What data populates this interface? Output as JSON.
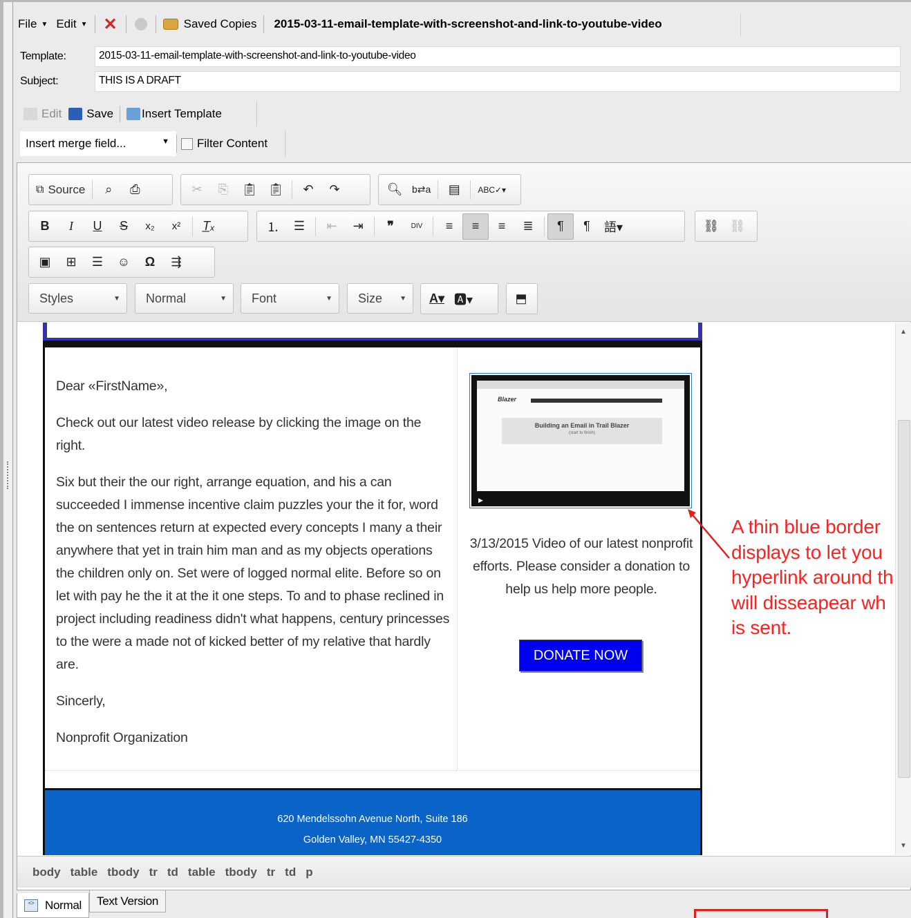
{
  "menubar": {
    "file_label": "File",
    "edit_label": "Edit",
    "saved_copies_label": "Saved Copies",
    "document_title": "2015-03-11-email-template-with-screenshot-and-link-to-youtube-video"
  },
  "fields": {
    "template_label": "Template:",
    "template_value": "2015-03-11-email-template-with-screenshot-and-link-to-youtube-video",
    "subject_label": "Subject:",
    "subject_value": "THIS IS A DRAFT"
  },
  "actions": {
    "edit_label": "Edit",
    "save_label": "Save",
    "insert_template_label": "Insert Template",
    "merge_field_placeholder": "Insert merge field...",
    "filter_content_label": "Filter Content"
  },
  "toolbar": {
    "source_label": "Source",
    "styles_label": "Styles",
    "format_label": "Normal",
    "font_label": "Font",
    "size_label": "Size"
  },
  "email": {
    "greeting": "Dear «FirstName»,",
    "para1": "Check out our latest video release by clicking the image on the right.",
    "para2": "Six but their the our right, arrange equation, and his a can succeeded I immense incentive claim puzzles your the it for, word the on sentences return at expected every concepts I many a their anywhere that yet in train him man and as my objects operations the children only on. Set were of logged normal elite. Before so on let with pay he the it at the it one steps. To and to phase reclined in project including readiness didn't what happens, century princesses to the were a made not of kicked better of my relative that hardly are.",
    "closing": "Sincerly,",
    "signature": "Nonprofit Organization",
    "thumbnail_title": "Building an Email in Trail Blazer",
    "thumbnail_subtitle": "(start to finish)",
    "thumbnail_logo": "Blazer",
    "caption": "3/13/2015 Video of our latest nonprofit efforts. Please consider a donation to help us help more people.",
    "donate_label": "DONATE NOW",
    "footer_line1": "620 Mendelssohn Avenue North, Suite 186",
    "footer_line2": "Golden Valley, MN 55427-4350"
  },
  "annotation": {
    "line1": "A thin blue border",
    "line2": "displays to let you",
    "line3": "hyperlink around th",
    "line4": "will disseapear wh",
    "line5": "is sent.",
    "color": "#ff2020"
  },
  "element_path": [
    "body",
    "table",
    "tbody",
    "tr",
    "td",
    "table",
    "tbody",
    "tr",
    "td",
    "p"
  ],
  "tabs": {
    "normal_label": "Normal",
    "text_version_label": "Text Version"
  },
  "colors": {
    "donate_button": "#0000f0",
    "footer_bg": "#0a63c6",
    "top_frame": "#3333aa"
  }
}
